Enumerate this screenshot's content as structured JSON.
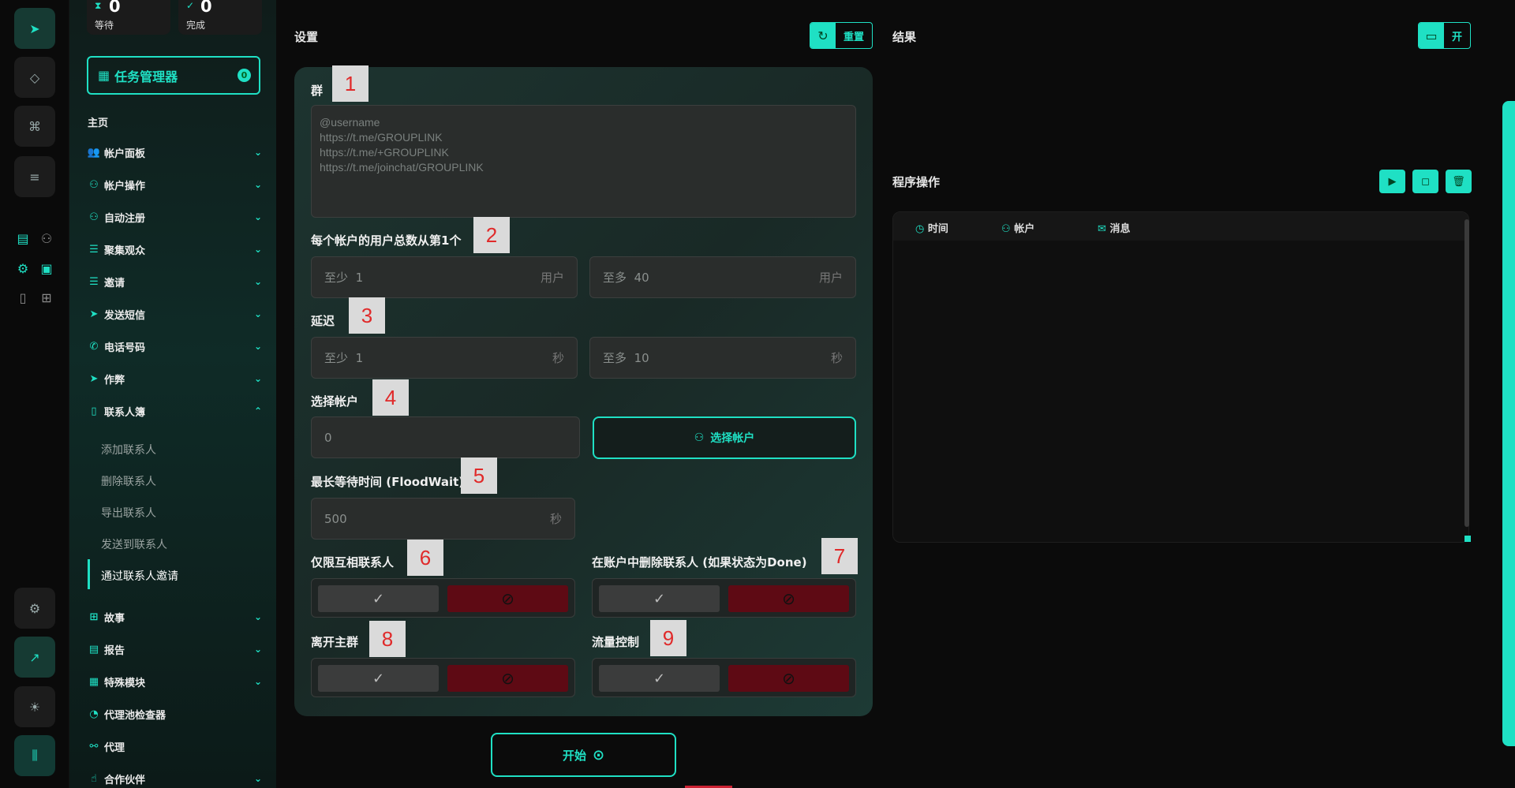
{
  "rail": {
    "icons": [
      "send-icon",
      "diamond-icon",
      "command-icon",
      "database-icon",
      "settings-icon",
      "external-link-icon",
      "sun-icon",
      "sliders-icon"
    ]
  },
  "stats": [
    {
      "value": "0",
      "label": "等待"
    },
    {
      "value": "0",
      "label": "完成"
    }
  ],
  "task_manager": {
    "label": "任务管理器",
    "count": "0"
  },
  "sidebar": {
    "section": "主页",
    "items": [
      {
        "label": "帐户面板"
      },
      {
        "label": "帐户操作"
      },
      {
        "label": "自动注册"
      },
      {
        "label": "聚集观众"
      },
      {
        "label": "邀请"
      },
      {
        "label": "发送短信"
      },
      {
        "label": "电话号码"
      },
      {
        "label": "作弊"
      },
      {
        "label": "联系人簿"
      }
    ],
    "subitems": [
      {
        "label": "添加联系人"
      },
      {
        "label": "删除联系人"
      },
      {
        "label": "导出联系人"
      },
      {
        "label": "发送到联系人"
      },
      {
        "label": "通过联系人邀请"
      }
    ],
    "items2": [
      {
        "label": "故事"
      },
      {
        "label": "报告"
      },
      {
        "label": "特殊模块"
      },
      {
        "label": "代理池检查器"
      },
      {
        "label": "代理"
      },
      {
        "label": "合作伙伴"
      }
    ]
  },
  "settings": {
    "title": "设置",
    "reset": "重置",
    "group_label": "群",
    "group_placeholder": "@username\nhttps://t.me/GROUPLINK\nhttps://t.me/+GROUPLINK\nhttps://t.me/joinchat/GROUPLINK",
    "users_label": "每个帐户的用户总数从第1个",
    "min_prefix": "至少",
    "max_prefix": "至多",
    "users_min": "1",
    "users_max": "40",
    "users_unit": "用户",
    "delay_label": "延迟",
    "delay_min": "1",
    "delay_max": "10",
    "sec_unit": "秒",
    "account_label": "选择帐户",
    "account_value": "0",
    "select_account": "选择帐户",
    "floodwait_label": "最长等待时间 (FloodWait)",
    "floodwait_value": "500",
    "mutual_label": "仅限互相联系人",
    "delete_label": "在账户中删除联系人 (如果状态为Done)",
    "leave_label": "离开主群",
    "flow_label": "流量控制",
    "start": "开始"
  },
  "annotations": [
    "1",
    "2",
    "3",
    "4",
    "5",
    "6",
    "7",
    "8",
    "9"
  ],
  "results": {
    "title": "结果",
    "open": "开"
  },
  "ops": {
    "title": "程序操作",
    "col_time": "时间",
    "col_account": "帐户",
    "col_message": "消息"
  },
  "colors": {
    "accent": "#1fe0c4",
    "deny": "#5e0a14"
  }
}
